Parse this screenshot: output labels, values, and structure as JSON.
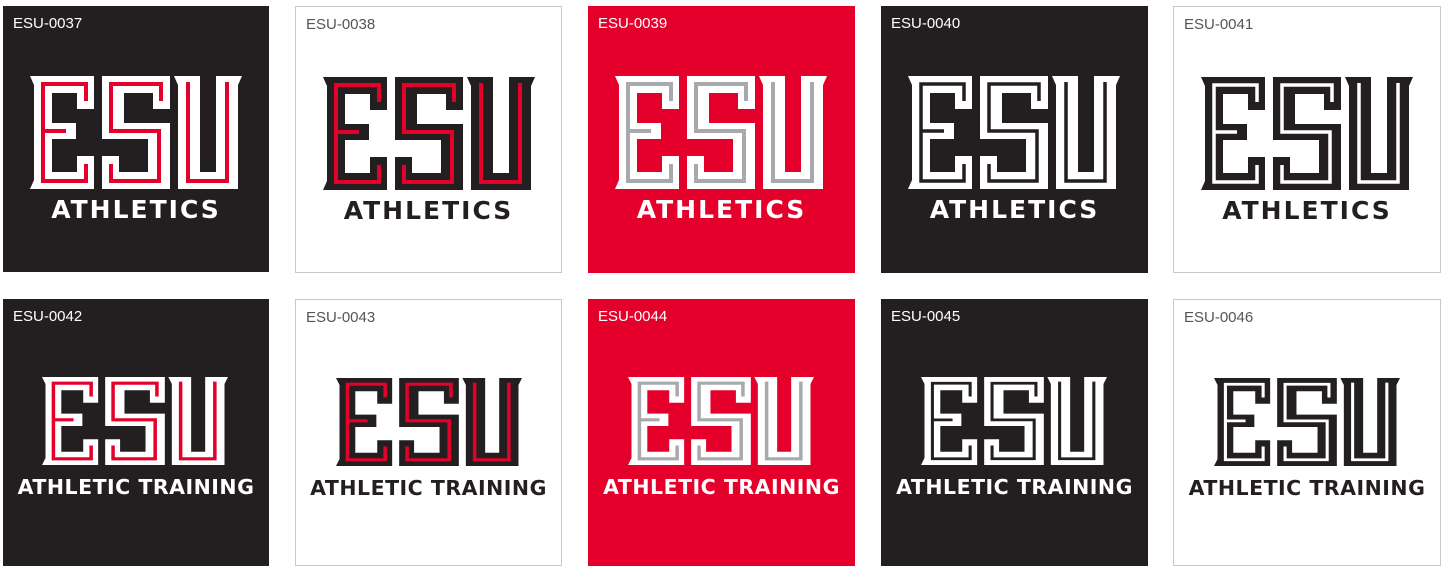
{
  "colors": {
    "black": "#231f20",
    "red": "#e4002b",
    "white": "#ffffff",
    "gray": "#a7a9ac"
  },
  "logo": {
    "wordmark": "ESU"
  },
  "rows": [
    {
      "subtitle": "ATHLETICS",
      "tiles": [
        {
          "code": "ESU-0037",
          "background": "#231f20",
          "outer": "#ffffff",
          "inner": "#e4002b",
          "text": "#ffffff"
        },
        {
          "code": "ESU-0038",
          "background": "#ffffff",
          "outer": "#231f20",
          "inner": "#e4002b",
          "text": "#231f20"
        },
        {
          "code": "ESU-0039",
          "background": "#e4002b",
          "outer": "#ffffff",
          "inner": "#a7a9ac",
          "text": "#ffffff"
        },
        {
          "code": "ESU-0040",
          "background": "#231f20",
          "outer": "#ffffff",
          "inner": "#231f20",
          "text": "#ffffff"
        },
        {
          "code": "ESU-0041",
          "background": "#ffffff",
          "outer": "#231f20",
          "inner": "#ffffff",
          "text": "#231f20"
        }
      ]
    },
    {
      "subtitle": "ATHLETIC TRAINING",
      "tiles": [
        {
          "code": "ESU-0042",
          "background": "#231f20",
          "outer": "#ffffff",
          "inner": "#e4002b",
          "text": "#ffffff"
        },
        {
          "code": "ESU-0043",
          "background": "#ffffff",
          "outer": "#231f20",
          "inner": "#e4002b",
          "text": "#231f20"
        },
        {
          "code": "ESU-0044",
          "background": "#e4002b",
          "outer": "#ffffff",
          "inner": "#a7a9ac",
          "text": "#ffffff"
        },
        {
          "code": "ESU-0045",
          "background": "#231f20",
          "outer": "#ffffff",
          "inner": "#231f20",
          "text": "#ffffff"
        },
        {
          "code": "ESU-0046",
          "background": "#ffffff",
          "outer": "#231f20",
          "inner": "#ffffff",
          "text": "#231f20"
        }
      ]
    }
  ]
}
